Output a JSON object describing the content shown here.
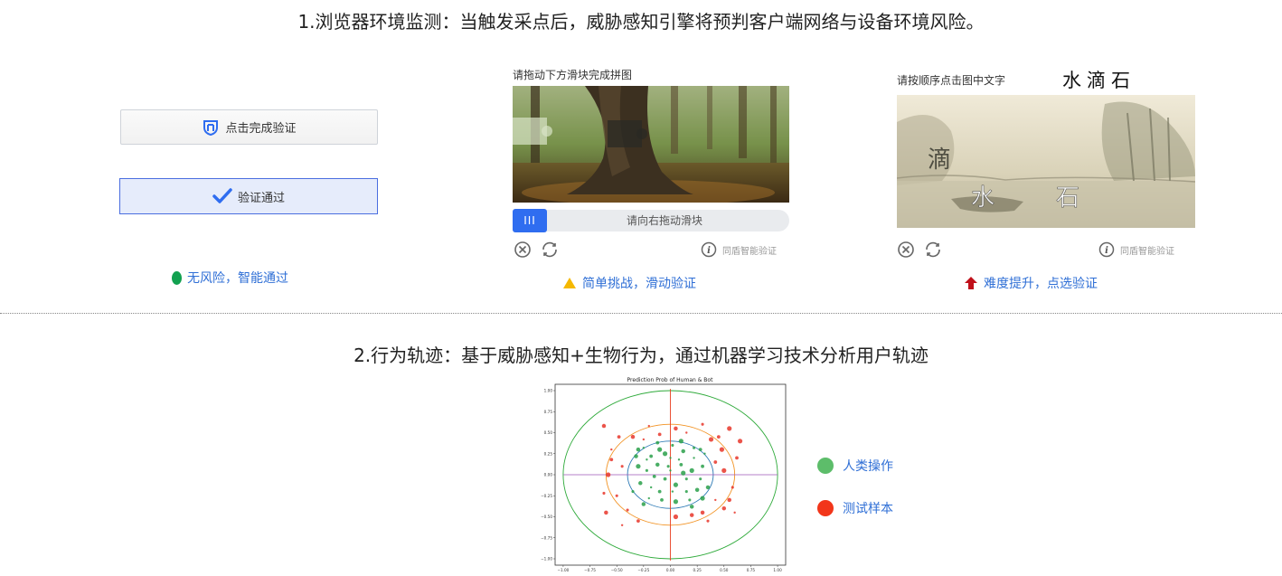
{
  "section1": {
    "title": "1.浏览器环境监测：当触发采点后，威胁感知引擎将预判客户端网络与设备环境风险。",
    "click_button_label": "点击完成验证",
    "pass_button_label": "验证通过",
    "status_no_risk": "无风险，智能通过",
    "slide_captcha": {
      "label": "请拖动下方滑块完成拼图",
      "slider_hint": "请向右拖动滑块",
      "handle_glyph": "III",
      "brand": "同盾智能验证",
      "status": "简单挑战，滑动验证"
    },
    "click_captcha": {
      "label": "请按顺序点击图中文字",
      "target_chars": "水滴石",
      "image_chars": [
        "滴",
        "水",
        "石"
      ],
      "brand": "同盾智能验证",
      "status": "难度提升，点选验证"
    },
    "colors": {
      "accent": "#2f6df0",
      "green": "#12a150",
      "yellow": "#f5b800",
      "red": "#c0101a"
    }
  },
  "section2": {
    "title": "2.行为轨迹：基于威胁感知+生物行为，通过机器学习技术分析用户轨迹",
    "legend": [
      {
        "label": "人类操作",
        "color": "#5dbd6a"
      },
      {
        "label": "测试样本",
        "color": "#f2361a"
      }
    ]
  },
  "chart_data": {
    "type": "scatter",
    "title": "Prediction Prob of Human & Bot",
    "xlim": [
      -1.0,
      1.0
    ],
    "ylim": [
      -1.0,
      1.0
    ],
    "xticks": [
      "−1.00",
      "−0.75",
      "−0.50",
      "−0.25",
      "0.00",
      "0.25",
      "0.50",
      "0.75",
      "1.00"
    ],
    "yticks": [
      "1.00",
      "0.75",
      "0.50",
      "0.25",
      "0.00",
      "−0.25",
      "−0.50",
      "−0.75",
      "−1.00"
    ],
    "circles": [
      {
        "radius": 0.4,
        "color": "#2a78b4"
      },
      {
        "radius": 0.6,
        "color": "#f29222"
      },
      {
        "radius": 1.0,
        "color": "#2eaa3a"
      }
    ],
    "axes_lines": {
      "horizontal_color": "#9b59b6",
      "vertical_color": "#e84020"
    },
    "series": [
      {
        "name": "人类操作",
        "color": "#2aa04a",
        "points": [
          [
            -0.25,
            0.32
          ],
          [
            -0.18,
            0.22
          ],
          [
            -0.1,
            0.3
          ],
          [
            0.02,
            0.35
          ],
          [
            0.12,
            0.28
          ],
          [
            0.22,
            0.2
          ],
          [
            0.3,
            0.1
          ],
          [
            -0.3,
            0.1
          ],
          [
            -0.22,
            0.05
          ],
          [
            -0.12,
            0.12
          ],
          [
            0.0,
            0.2
          ],
          [
            0.1,
            0.12
          ],
          [
            0.2,
            0.05
          ],
          [
            0.28,
            -0.05
          ],
          [
            -0.28,
            -0.1
          ],
          [
            -0.18,
            -0.15
          ],
          [
            -0.05,
            -0.05
          ],
          [
            0.05,
            -0.12
          ],
          [
            0.15,
            -0.2
          ],
          [
            0.25,
            -0.18
          ],
          [
            -0.2,
            -0.28
          ],
          [
            -0.08,
            -0.3
          ],
          [
            0.05,
            -0.32
          ],
          [
            0.18,
            -0.3
          ],
          [
            -0.32,
            0.22
          ],
          [
            0.32,
            0.25
          ],
          [
            -0.12,
            0.38
          ],
          [
            0.1,
            0.4
          ],
          [
            -0.35,
            -0.2
          ],
          [
            0.35,
            -0.15
          ],
          [
            0.0,
            0.05
          ],
          [
            -0.15,
            -0.02
          ],
          [
            0.12,
            0.02
          ],
          [
            0.22,
            0.32
          ],
          [
            -0.25,
            -0.35
          ],
          [
            0.02,
            -0.2
          ],
          [
            0.28,
            0.3
          ],
          [
            -0.05,
            0.25
          ],
          [
            0.15,
            -0.05
          ],
          [
            -0.3,
            0.3
          ],
          [
            0.08,
            0.18
          ],
          [
            -0.1,
            -0.2
          ],
          [
            0.3,
            -0.28
          ],
          [
            -0.02,
            0.1
          ],
          [
            0.2,
            -0.38
          ],
          [
            -0.22,
            0.18
          ]
        ]
      },
      {
        "name": "测试样本",
        "color": "#e8362a",
        "points": [
          [
            -0.62,
            0.58
          ],
          [
            -0.55,
            0.3
          ],
          [
            -0.48,
            0.45
          ],
          [
            -0.58,
            0.0
          ],
          [
            -0.5,
            -0.25
          ],
          [
            -0.6,
            -0.45
          ],
          [
            -0.45,
            -0.6
          ],
          [
            -0.3,
            -0.55
          ],
          [
            0.05,
            -0.5
          ],
          [
            0.35,
            -0.55
          ],
          [
            0.5,
            -0.4
          ],
          [
            0.6,
            -0.45
          ],
          [
            0.45,
            0.45
          ],
          [
            0.55,
            0.55
          ],
          [
            0.3,
            0.6
          ],
          [
            0.05,
            0.55
          ],
          [
            -0.2,
            0.58
          ],
          [
            0.62,
            0.2
          ],
          [
            0.5,
            0.05
          ],
          [
            0.58,
            -0.15
          ],
          [
            -0.35,
            0.45
          ],
          [
            0.42,
            -0.3
          ],
          [
            -0.55,
            0.18
          ],
          [
            0.65,
            0.4
          ],
          [
            -0.4,
            -0.42
          ],
          [
            0.3,
            -0.45
          ],
          [
            0.15,
            0.5
          ],
          [
            -0.1,
            0.48
          ],
          [
            0.48,
            0.3
          ],
          [
            -0.62,
            -0.22
          ],
          [
            0.2,
            -0.48
          ],
          [
            -0.25,
            0.42
          ],
          [
            0.42,
            0.15
          ],
          [
            0.38,
            0.42
          ],
          [
            -0.45,
            0.1
          ],
          [
            0.55,
            -0.3
          ]
        ]
      }
    ]
  }
}
